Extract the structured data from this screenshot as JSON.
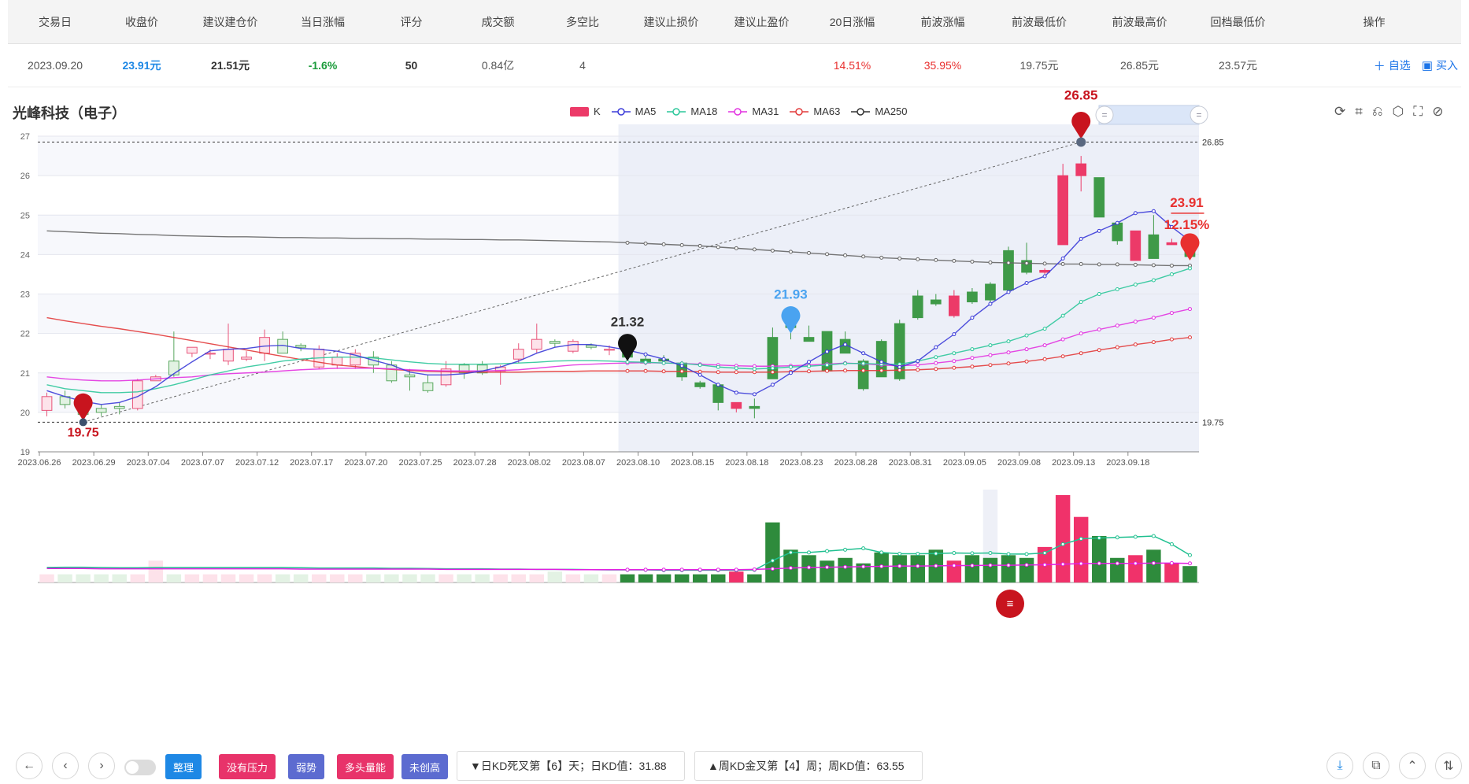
{
  "table": {
    "headers": [
      "交易日",
      "收盘价",
      "建议建仓价",
      "当日涨幅",
      "评分",
      "成交额",
      "多空比",
      "建议止损价",
      "建议止盈价",
      "20日涨幅",
      "前波涨幅",
      "前波最低价",
      "前波最高价",
      "回档最低价",
      "操作"
    ],
    "row": [
      "2023.09.20",
      "23.91元",
      "21.51元",
      "-1.6%",
      "50",
      "0.84亿",
      "4",
      "",
      "",
      "14.51%",
      "35.95%",
      "19.75元",
      "26.85元",
      "23.57元"
    ],
    "ops": {
      "watch_icon": "plus-icon",
      "watch": "自选",
      "buy_icon": "buy-icon",
      "buy": "买入"
    },
    "colors": {
      "close": "#1e88e5",
      "change": "#1a9b3a",
      "up": "#e8302f"
    }
  },
  "chart": {
    "title": "光峰科技（电子）",
    "legend": [
      "K",
      "MA5",
      "MA18",
      "MA31",
      "MA63",
      "MA250"
    ],
    "legend_colors": [
      "#ec3a68",
      "#3b3bd8",
      "#2cc79a",
      "#e233e0",
      "#e23a3a",
      "#333333"
    ],
    "toolbox_icons": [
      "restore-icon",
      "zoom-in-icon",
      "zoom-back-icon",
      "drag-icon",
      "select-icon",
      "brush-clear-icon"
    ]
  },
  "chart_data": {
    "type": "candlestick",
    "x_ticks": [
      "2023.06.26",
      "2023.06.29",
      "2023.07.04",
      "2023.07.07",
      "2023.07.12",
      "2023.07.17",
      "2023.07.20",
      "2023.07.25",
      "2023.07.28",
      "2023.08.02",
      "2023.08.07",
      "2023.08.10",
      "2023.08.15",
      "2023.08.18",
      "2023.08.23",
      "2023.08.28",
      "2023.08.31",
      "2023.09.05",
      "2023.09.08",
      "2023.09.13",
      "2023.09.18"
    ],
    "y_ticks": [
      19,
      20,
      21,
      22,
      23,
      24,
      25,
      26,
      27
    ],
    "ylim": [
      19,
      27.3
    ],
    "candles": [
      [
        20.05,
        20.4,
        19.9,
        20.5
      ],
      [
        20.4,
        20.2,
        20.1,
        20.55
      ],
      [
        20.2,
        19.95,
        19.8,
        20.4
      ],
      [
        20.1,
        20.0,
        19.9,
        20.2
      ],
      [
        20.15,
        20.1,
        19.95,
        20.25
      ],
      [
        20.1,
        20.8,
        20.05,
        20.85
      ],
      [
        20.8,
        20.9,
        20.8,
        20.95
      ],
      [
        21.3,
        20.95,
        20.9,
        22.05
      ],
      [
        21.5,
        21.65,
        21.4,
        21.65
      ],
      [
        21.5,
        21.5,
        21.35,
        21.6
      ],
      [
        21.3,
        21.6,
        21.2,
        22.25
      ],
      [
        21.35,
        21.4,
        21.3,
        21.55
      ],
      [
        21.5,
        21.9,
        21.3,
        22.1
      ],
      [
        21.85,
        21.5,
        21.5,
        22.05
      ],
      [
        21.7,
        21.65,
        21.55,
        21.75
      ],
      [
        21.15,
        21.6,
        21.1,
        21.7
      ],
      [
        21.2,
        21.4,
        21.1,
        21.5
      ],
      [
        21.2,
        21.5,
        21.1,
        21.6
      ],
      [
        21.4,
        21.2,
        21.0,
        21.55
      ],
      [
        21.2,
        20.8,
        20.75,
        21.3
      ],
      [
        20.95,
        20.9,
        20.55,
        21.1
      ],
      [
        20.75,
        20.55,
        20.5,
        20.95
      ],
      [
        20.7,
        21.1,
        20.65,
        21.3
      ],
      [
        21.2,
        21.0,
        20.85,
        21.25
      ],
      [
        21.2,
        21.0,
        20.95,
        21.3
      ],
      [
        21.05,
        21.15,
        20.7,
        21.2
      ],
      [
        21.35,
        21.6,
        21.25,
        21.75
      ],
      [
        21.6,
        21.85,
        21.5,
        22.25
      ],
      [
        21.8,
        21.75,
        21.65,
        21.85
      ],
      [
        21.55,
        21.8,
        21.5,
        21.85
      ],
      [
        21.7,
        21.65,
        21.6,
        21.75
      ],
      [
        21.6,
        21.6,
        21.45,
        21.7
      ],
      [
        21.5,
        21.4,
        21.35,
        21.55
      ],
      [
        21.35,
        21.25,
        21.2,
        21.5
      ],
      [
        21.35,
        21.3,
        21.2,
        21.45
      ],
      [
        21.25,
        20.9,
        20.8,
        21.3
      ],
      [
        20.75,
        20.65,
        20.6,
        20.8
      ],
      [
        20.7,
        20.25,
        20.05,
        20.75
      ],
      [
        20.1,
        20.25,
        20.0,
        20.25
      ],
      [
        20.15,
        20.1,
        19.85,
        20.35
      ],
      [
        21.9,
        20.85,
        20.85,
        22.15
      ],
      [
        22.2,
        22.15,
        21.85,
        22.5
      ],
      [
        21.9,
        21.8,
        21.8,
        22.2
      ],
      [
        22.05,
        21.05,
        21.05,
        22.0
      ],
      [
        21.85,
        21.5,
        21.5,
        22.05
      ],
      [
        21.3,
        20.6,
        20.55,
        21.35
      ],
      [
        21.8,
        20.9,
        20.9,
        21.85
      ],
      [
        22.25,
        20.85,
        20.8,
        22.35
      ],
      [
        22.95,
        22.4,
        22.35,
        23.1
      ],
      [
        22.85,
        22.75,
        22.7,
        23.0
      ],
      [
        22.45,
        22.95,
        22.4,
        23.1
      ],
      [
        23.05,
        22.8,
        22.75,
        23.15
      ],
      [
        23.25,
        22.85,
        22.7,
        23.3
      ],
      [
        24.1,
        23.1,
        23.05,
        24.2
      ],
      [
        23.85,
        23.55,
        23.5,
        24.3
      ],
      [
        23.55,
        23.6,
        23.5,
        23.65
      ],
      [
        24.25,
        26.0,
        24.25,
        26.3
      ],
      [
        26.0,
        26.3,
        25.6,
        26.5
      ],
      [
        25.95,
        24.95,
        24.95,
        25.95
      ],
      [
        24.8,
        24.35,
        24.25,
        24.85
      ],
      [
        23.85,
        24.6,
        23.85,
        24.6
      ],
      [
        24.5,
        23.9,
        23.9,
        25.0
      ],
      [
        24.25,
        24.3,
        24.25,
        24.4
      ],
      [
        24.1,
        23.95,
        23.9,
        24.25
      ]
    ],
    "ma5": [
      20.55,
      20.4,
      20.28,
      20.2,
      20.25,
      20.4,
      20.65,
      20.98,
      21.28,
      21.56,
      21.6,
      21.62,
      21.68,
      21.7,
      21.62,
      21.6,
      21.55,
      21.45,
      21.32,
      21.2,
      21.02,
      20.95,
      20.95,
      20.98,
      21.05,
      21.15,
      21.3,
      21.5,
      21.65,
      21.72,
      21.72,
      21.66,
      21.58,
      21.47,
      21.35,
      21.18,
      20.95,
      20.7,
      20.5,
      20.46,
      20.7,
      21.0,
      21.28,
      21.54,
      21.72,
      21.5,
      21.28,
      21.15,
      21.3,
      21.65,
      21.98,
      22.4,
      22.75,
      23.05,
      23.28,
      23.45,
      23.9,
      24.4,
      24.6,
      24.8,
      25.05,
      25.1,
      24.7,
      24.35
    ],
    "ma18": [
      20.7,
      20.6,
      20.55,
      20.5,
      20.5,
      20.52,
      20.6,
      20.7,
      20.82,
      20.95,
      21.05,
      21.15,
      21.22,
      21.3,
      21.35,
      21.38,
      21.4,
      21.4,
      21.38,
      21.33,
      21.28,
      21.24,
      21.22,
      21.22,
      21.22,
      21.23,
      21.25,
      21.27,
      21.3,
      21.31,
      21.31,
      21.3,
      21.28,
      21.27,
      21.25,
      21.24,
      21.2,
      21.15,
      21.12,
      21.1,
      21.12,
      21.15,
      21.17,
      21.2,
      21.24,
      21.24,
      21.22,
      21.22,
      21.3,
      21.4,
      21.5,
      21.6,
      21.7,
      21.8,
      21.95,
      22.12,
      22.45,
      22.8,
      23.0,
      23.12,
      23.24,
      23.35,
      23.5,
      23.65
    ],
    "ma31": [
      20.9,
      20.85,
      20.82,
      20.8,
      20.8,
      20.82,
      20.85,
      20.88,
      20.9,
      20.95,
      20.98,
      21.0,
      21.02,
      21.05,
      21.08,
      21.1,
      21.12,
      21.12,
      21.12,
      21.1,
      21.08,
      21.06,
      21.05,
      21.05,
      21.05,
      21.06,
      21.08,
      21.12,
      21.16,
      21.2,
      21.22,
      21.24,
      21.25,
      21.26,
      21.25,
      21.24,
      21.22,
      21.2,
      21.18,
      21.17,
      21.17,
      21.18,
      21.2,
      21.22,
      21.25,
      21.23,
      21.2,
      21.18,
      21.2,
      21.25,
      21.3,
      21.38,
      21.45,
      21.52,
      21.6,
      21.7,
      21.85,
      22.0,
      22.1,
      22.2,
      22.3,
      22.4,
      22.52,
      22.62
    ],
    "ma63": [
      22.4,
      22.32,
      22.25,
      22.18,
      22.12,
      22.05,
      21.98,
      21.9,
      21.82,
      21.74,
      21.66,
      21.58,
      21.5,
      21.42,
      21.34,
      21.27,
      21.2,
      21.16,
      21.12,
      21.09,
      21.06,
      21.04,
      21.03,
      21.02,
      21.02,
      21.02,
      21.02,
      21.03,
      21.04,
      21.04,
      21.05,
      21.05,
      21.05,
      21.05,
      21.04,
      21.04,
      21.03,
      21.02,
      21.02,
      21.02,
      21.02,
      21.03,
      21.04,
      21.05,
      21.06,
      21.06,
      21.06,
      21.07,
      21.08,
      21.1,
      21.13,
      21.16,
      21.2,
      21.24,
      21.29,
      21.35,
      21.42,
      21.5,
      21.58,
      21.65,
      21.72,
      21.78,
      21.85,
      21.9
    ],
    "ma250": [
      24.6,
      24.58,
      24.56,
      24.54,
      24.53,
      24.51,
      24.5,
      24.48,
      24.47,
      24.46,
      24.45,
      24.45,
      24.44,
      24.43,
      24.43,
      24.42,
      24.42,
      24.41,
      24.41,
      24.4,
      24.4,
      24.39,
      24.39,
      24.38,
      24.38,
      24.37,
      24.37,
      24.36,
      24.35,
      24.34,
      24.33,
      24.32,
      24.3,
      24.28,
      24.26,
      24.24,
      24.22,
      24.19,
      24.16,
      24.13,
      24.1,
      24.07,
      24.04,
      24.01,
      23.98,
      23.95,
      23.92,
      23.9,
      23.88,
      23.86,
      23.84,
      23.82,
      23.8,
      23.79,
      23.78,
      23.77,
      23.76,
      23.76,
      23.75,
      23.75,
      23.74,
      23.73,
      23.72,
      23.72
    ],
    "markers": {
      "low": {
        "index": 2,
        "value": "19.75"
      },
      "high": {
        "index": 57,
        "value": "26.85"
      },
      "mark_a": {
        "index": 32,
        "value": "21.32"
      },
      "mark_b": {
        "index": 41,
        "value": "21.93"
      },
      "last": {
        "index": 63,
        "value": "23.91",
        "pct": "12.15%"
      }
    },
    "ref_lines": [
      "26.85",
      "19.75"
    ],
    "volume": [
      3,
      3,
      3,
      3,
      3,
      3,
      8,
      3,
      3,
      3,
      3,
      3,
      3,
      3,
      3,
      3,
      3,
      3,
      3,
      3,
      3,
      3,
      3,
      3,
      3,
      3,
      3,
      3,
      4,
      3,
      3,
      3,
      3,
      3,
      3,
      3,
      3,
      3,
      4,
      3,
      22,
      12,
      10,
      8,
      9,
      7,
      11,
      10,
      10,
      12,
      8,
      10,
      9,
      10,
      9,
      13,
      32,
      24,
      17,
      9,
      10,
      12,
      7,
      6
    ],
    "volume_faded_until": 32,
    "vol_ma1": [
      5.5,
      5.6,
      5.6,
      5.5,
      5.4,
      5.4,
      5.5,
      5.5,
      5.5,
      5.5,
      5.5,
      5.5,
      5.5,
      5.5,
      5.4,
      5.3,
      5.3,
      5.3,
      5.3,
      5.2,
      5.2,
      5.1,
      5.0,
      5.0,
      5.0,
      4.9,
      4.9,
      4.8,
      4.8,
      4.8,
      4.7,
      4.6,
      4.6,
      4.6,
      4.5,
      4.5,
      4.5,
      4.5,
      4.5,
      4.6,
      8,
      11,
      11,
      11.5,
      12,
      12.5,
      11,
      10.5,
      10.5,
      10.6,
      10.8,
      10.7,
      10.8,
      10.4,
      10.4,
      10.8,
      14,
      16,
      16.3,
      16.5,
      16.7,
      17,
      14,
      10
    ],
    "vol_ma2": [
      5.1,
      5.1,
      5.1,
      5.0,
      5.0,
      5.0,
      5.0,
      5.0,
      5.0,
      5.0,
      5.0,
      5.0,
      5.0,
      5.0,
      4.9,
      4.9,
      4.9,
      4.9,
      4.9,
      4.9,
      4.9,
      4.9,
      4.8,
      4.8,
      4.8,
      4.8,
      4.8,
      4.8,
      4.8,
      4.7,
      4.7,
      4.7,
      4.7,
      4.7,
      4.7,
      4.7,
      4.7,
      4.7,
      4.7,
      4.8,
      5.0,
      5.3,
      5.5,
      5.6,
      5.7,
      5.8,
      5.9,
      6.0,
      6.0,
      6.1,
      6.2,
      6.2,
      6.3,
      6.3,
      6.4,
      6.5,
      6.7,
      6.9,
      7.0,
      7.0,
      7.0,
      7.1,
      7.1,
      7.0
    ]
  },
  "bottom": {
    "nav_icons": [
      "arrow-left-icon",
      "chevron-left-icon",
      "chevron-right-icon"
    ],
    "tags": [
      {
        "label": "整理",
        "color": "#1e88e5"
      },
      {
        "label": "没有压力",
        "color": "#e8336a"
      },
      {
        "label": "弱势",
        "color": "#5c6bd0"
      },
      {
        "label": "多头量能",
        "color": "#e8336a"
      },
      {
        "label": "未创高",
        "color": "#5c6bd0"
      }
    ],
    "kd_day": "▼日KD死叉第【6】天；日KD值：31.88",
    "kd_week": "▲周KD金叉第【4】周；周KD值：63.55",
    "right_icons": [
      "download-icon",
      "copy-icon",
      "chevron-up-icon",
      "sort-icon"
    ]
  }
}
